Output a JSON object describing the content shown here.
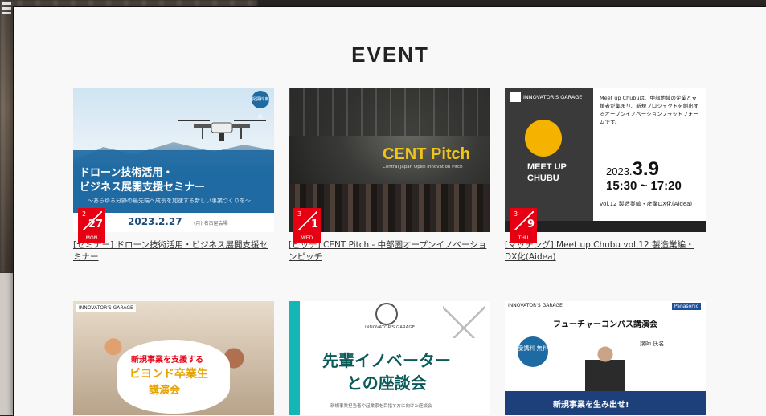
{
  "section_title": "EVENT",
  "events": [
    {
      "thumb_heading_1": "ドローン技術活用・",
      "thumb_heading_2": "ビジネス展開支援セミナー",
      "thumb_sub": "〜あらゆる分野の最先端へ成長を加速する新しい事業づくりを〜",
      "thumb_date": "2023.2.27",
      "thumb_date_note": "(月) 名古屋会場",
      "thumb_tag": "受講料 無料",
      "badge": {
        "month": "2",
        "day": "27",
        "weekday": "MON"
      },
      "caption": "[セミナー] ドローン技術活用・ビジネス展開支援セミナー"
    },
    {
      "thumb_logo": "CENT Pitch",
      "thumb_sub": "Central Japan Open Innovation Pitch",
      "badge": {
        "month": "3",
        "day": "1",
        "weekday": "WED"
      },
      "caption": "[ピッチ] CENT Pitch - 中部圏オープンイノベーションピッチ"
    },
    {
      "thumb_header": "INNOVATOR'S GARAGE",
      "thumb_logo_text": "MEET UP CHUBU",
      "thumb_desc": "Meet up Chubuは、中部地域の企業と支援者が集まり、新規プロジェクトを創出するオープンイノベーションプラットフォームです。",
      "thumb_year": "2023.",
      "thumb_date": "3.9",
      "thumb_time": "15:30 ~ 17:20",
      "thumb_vol": "vol.12 製造業編・産業DX化(Aidea)",
      "badge": {
        "month": "3",
        "day": "9",
        "weekday": "THU"
      },
      "caption": "[マッチング] Meet up Chubu vol.12 製造業編・DX化(Aidea)"
    },
    {
      "thumb_header": "INNOVATOR'S GARAGE",
      "thumb_line_1": "新規事業を支援する",
      "thumb_line_2": "ビヨンド卒業生",
      "thumb_line_3": "講演会"
    },
    {
      "thumb_header": "INNOVATOR'S GARAGE",
      "thumb_line_1": "先輩イノベーター",
      "thumb_line_2": "との座談会",
      "thumb_note": "新規事業担当者や起業家を目指す方に向けた座談会"
    },
    {
      "thumb_header": "INNOVATOR'S GARAGE",
      "thumb_logo": "Panasonic",
      "thumb_title": "フューチャーコンパス講演会",
      "thumb_circle": "受講料 無料",
      "thumb_name": "講師 氏名",
      "thumb_banner": "新規事業を生み出せ!"
    }
  ]
}
